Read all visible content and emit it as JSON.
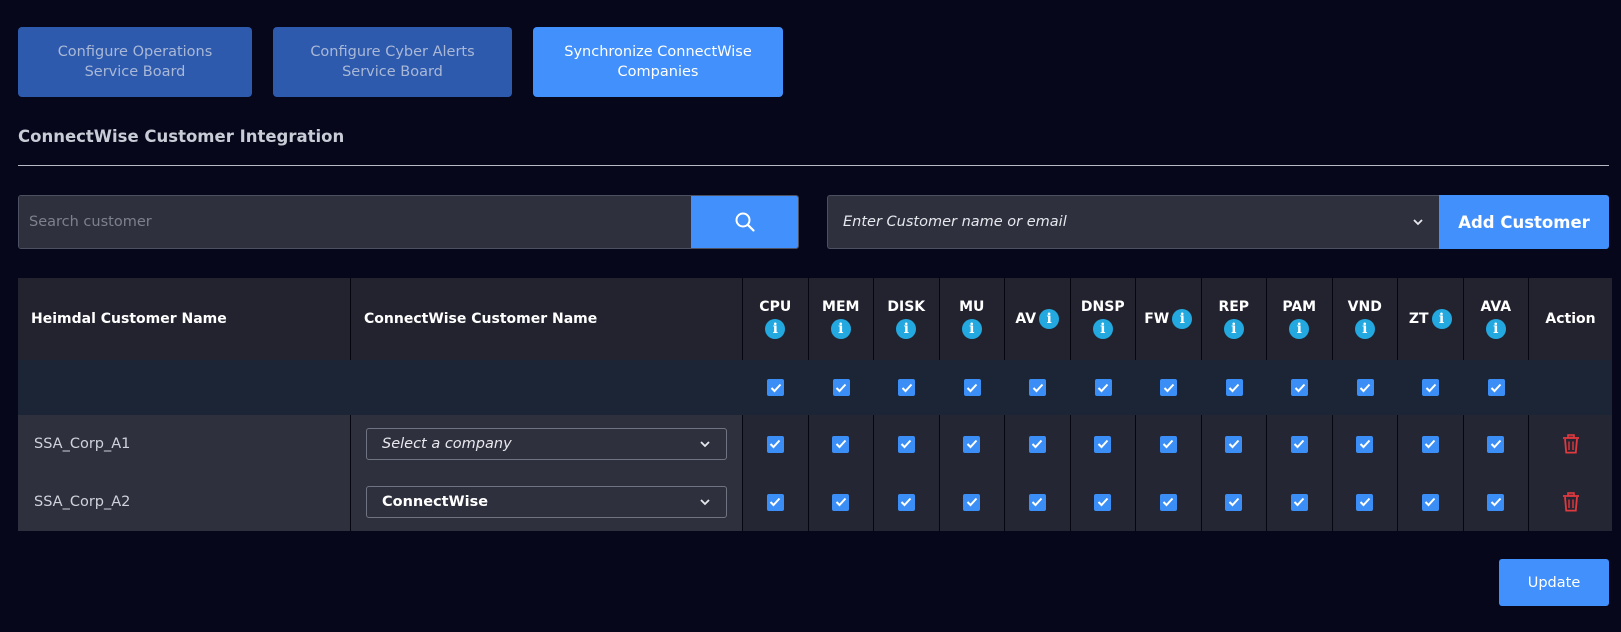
{
  "tabs": [
    {
      "line1": "Configure Operations",
      "line2": "Service Board",
      "active": false
    },
    {
      "line1": "Configure Cyber Alerts",
      "line2": "Service Board",
      "active": false
    },
    {
      "line1": "Synchronize ConnectWise",
      "line2": "Companies",
      "active": true
    }
  ],
  "section_title": "ConnectWise Customer Integration",
  "search": {
    "placeholder": "Search customer",
    "icon": "search-icon"
  },
  "customer_select": {
    "placeholder": "Enter Customer name or email",
    "icon": "chevron-down-icon"
  },
  "add_customer_label": "Add Customer",
  "table": {
    "col_heimdal": "Heimdal Customer Name",
    "col_connectwise": "ConnectWise Customer Name",
    "metrics": [
      "CPU",
      "MEM",
      "DISK",
      "MU",
      "AV",
      "DNSP",
      "FW",
      "REP",
      "PAM",
      "VND",
      "ZT",
      "AVA"
    ],
    "col_action": "Action",
    "rows": [
      {
        "heimdal": "SSA_Corp_A1",
        "company": "Select a company",
        "company_is_placeholder": true
      },
      {
        "heimdal": "SSA_Corp_A2",
        "company": "ConnectWise",
        "company_is_placeholder": false
      }
    ]
  },
  "update_label": "Update",
  "colors": {
    "background": "#06071a",
    "accent": "#4290fb",
    "tab_inactive": "#2e5aae",
    "info": "#23a9e0",
    "danger": "#e0393e"
  }
}
